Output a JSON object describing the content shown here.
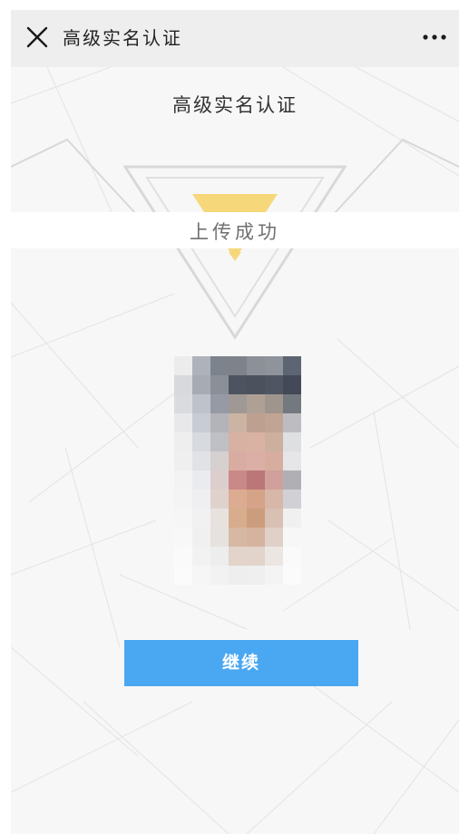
{
  "nav": {
    "title": "高级实名认证",
    "close_icon": "close-icon",
    "more_icon": "more-icon"
  },
  "content": {
    "page_title": "高级实名认证",
    "status_text": "上传成功",
    "continue_label": "继续"
  },
  "colors": {
    "nav_bg": "#eeeeee",
    "page_bg": "#f7f7f7",
    "button_bg": "#4aa8f2",
    "triangle_accent": "#f6d77a",
    "line": "#dcdcdc"
  },
  "photo": {
    "cols": 7,
    "pixels": [
      "#ececec",
      "#aeb2ba",
      "#7d838d",
      "#7e828a",
      "#8c9097",
      "#8f939b",
      "#5e6572",
      "#d7d9dd",
      "#a7abb3",
      "#8b8f97",
      "#4d5360",
      "#4b515d",
      "#4f5562",
      "#434957",
      "#d9dbdf",
      "#bec3cb",
      "#959aa4",
      "#9f9894",
      "#afa096",
      "#9f958d",
      "#74787f",
      "#e8e8ea",
      "#c8ccd4",
      "#b2b4ba",
      "#ccb4a5",
      "#bea091",
      "#c1a495",
      "#bdbdc1",
      "#eeeeee",
      "#d7dadf",
      "#bec0c5",
      "#d7b1a1",
      "#d9b2a3",
      "#ccaf9f",
      "#dedfe1",
      "#efefef",
      "#e0e2e6",
      "#d6d1d0",
      "#d9aca1",
      "#dbafa5",
      "#d6ad9f",
      "#e6e6e8",
      "#f3f3f3",
      "#eaebee",
      "#dccecd",
      "#c98987",
      "#bb7778",
      "#d0a09c",
      "#b0b0b4",
      "#f4f4f4",
      "#efeff1",
      "#dfd2cd",
      "#dbab92",
      "#d5a388",
      "#d7b7a7",
      "#d1d1d5",
      "#f6f6f6",
      "#f1f1f2",
      "#e8e2de",
      "#d7ad8e",
      "#cc9d7c",
      "#d8c0b2",
      "#f0f0f0",
      "#f8f8f8",
      "#f0f0f0",
      "#e6e2e0",
      "#d7b8a2",
      "#d6b39e",
      "#dfd0c8",
      "#f7f7f7",
      "#fafafa",
      "#f2f2f2",
      "#ededed",
      "#e2d4cb",
      "#e2d3cb",
      "#ebe6e2",
      "#fafafa",
      "#fbfbfb",
      "#f6f6f6",
      "#f2f2f2",
      "#eeeeee",
      "#efefef",
      "#f4f4f4",
      "#fbfbfb"
    ]
  }
}
